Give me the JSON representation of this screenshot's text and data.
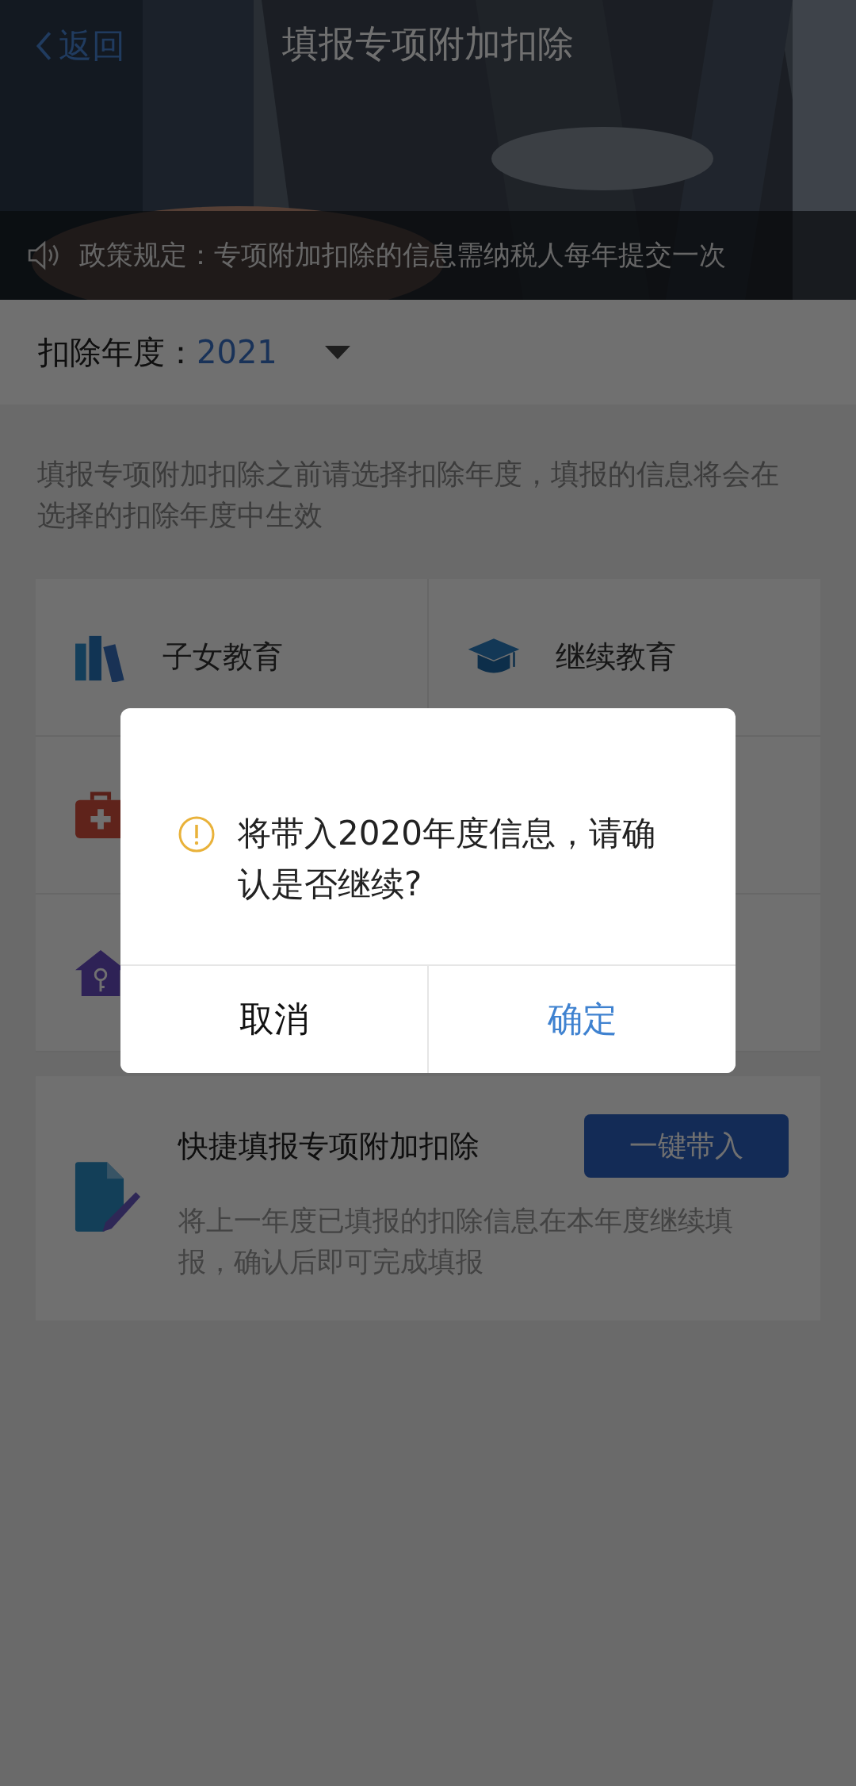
{
  "nav": {
    "back": "返回",
    "title": "填报专项附加扣除"
  },
  "notice": {
    "text": "政策规定：专项附加扣除的信息需纳税人每年提交一次"
  },
  "year_selector": {
    "label": "扣除年度：",
    "value": "2021"
  },
  "hint": "填报专项附加扣除之前请选择扣除年度，填报的信息将会在选择的扣除年度中生效",
  "deduction_rows": [
    {
      "cells": [
        {
          "kind": "books",
          "label": "子女教育"
        },
        {
          "kind": "cap",
          "label": "继续教育"
        }
      ]
    },
    {
      "cells": [
        {
          "kind": "medkit"
        }
      ]
    },
    {
      "cells": [
        {
          "kind": "house"
        }
      ]
    }
  ],
  "quick_fill": {
    "title": "快捷填报专项附加扣除",
    "description": "将上一年度已填报的扣除信息在本年度继续填报，确认后即可完成填报",
    "button": "一键带入"
  },
  "dialog": {
    "message": "将带入2020年度信息，请确认是否继续?",
    "buttons": [
      {
        "label": "取消",
        "kind": "cancel"
      },
      {
        "label": "确定",
        "kind": "confirm"
      }
    ]
  }
}
